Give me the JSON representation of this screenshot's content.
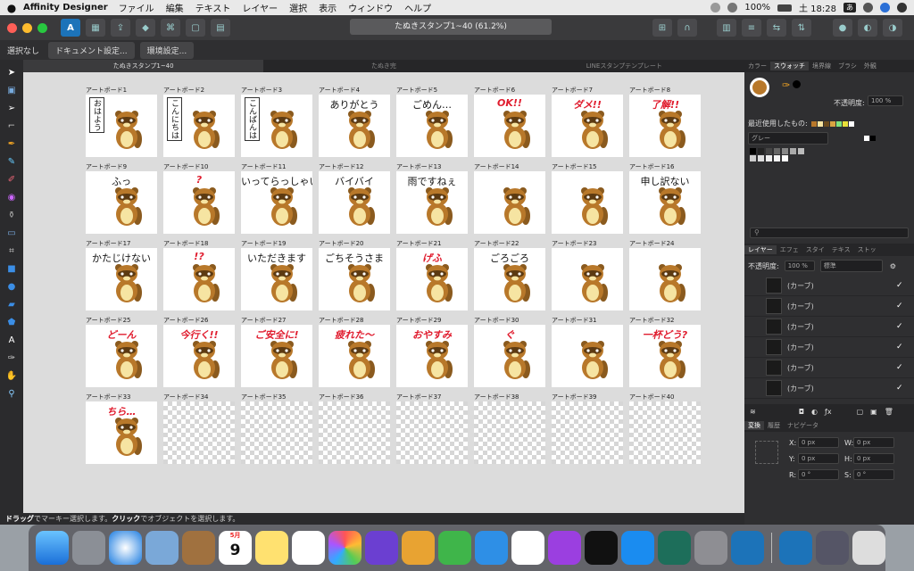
{
  "menubar": {
    "app_name": "Affinity Designer",
    "items": [
      "ファイル",
      "編集",
      "テキスト",
      "レイヤー",
      "選択",
      "表示",
      "ウィンドウ",
      "ヘルプ"
    ],
    "battery": "100%",
    "clock": "土 18:28",
    "input_badge": "あ"
  },
  "window": {
    "doc_title": "たぬきスタンプ1~40 (61.2%)"
  },
  "context_bar": {
    "selection_label": "選択なし",
    "doc_settings": "ドキュメント設定...",
    "env_settings": "環境設定..."
  },
  "doc_tabs": [
    {
      "label": "たぬきスタンプ1~40",
      "active": true
    },
    {
      "label": "たぬき完",
      "active": false
    },
    {
      "label": "LINEスタンプテンプレート",
      "active": false
    }
  ],
  "artboards": [
    {
      "label": "アートボード1",
      "caption": "おはよう",
      "style": "vert",
      "tanuki": true
    },
    {
      "label": "アートボード2",
      "caption": "こんにちは",
      "style": "vert",
      "tanuki": true
    },
    {
      "label": "アートボード3",
      "caption": "こんばんは",
      "style": "vert",
      "tanuki": true
    },
    {
      "label": "アートボード4",
      "caption": "ありがとう",
      "style": "normal",
      "tanuki": true
    },
    {
      "label": "アートボード5",
      "caption": "ごめん…",
      "style": "normal",
      "tanuki": true
    },
    {
      "label": "アートボード6",
      "caption": "OK!!",
      "style": "red",
      "tanuki": true
    },
    {
      "label": "アートボード7",
      "caption": "ダメ!!",
      "style": "red",
      "tanuki": true
    },
    {
      "label": "アートボード8",
      "caption": "了解!!",
      "style": "red",
      "tanuki": true
    },
    {
      "label": "アートボード9",
      "caption": "ふっ",
      "style": "normal",
      "tanuki": true
    },
    {
      "label": "アートボード10",
      "caption": "?",
      "style": "red",
      "tanuki": true
    },
    {
      "label": "アートボード11",
      "caption": "いってらっしゃい",
      "style": "normal",
      "tanuki": true
    },
    {
      "label": "アートボード12",
      "caption": "バイバイ",
      "style": "normal",
      "tanuki": true
    },
    {
      "label": "アートボード13",
      "caption": "雨ですねぇ",
      "style": "normal",
      "tanuki": true
    },
    {
      "label": "アートボード14",
      "caption": "",
      "style": "normal",
      "tanuki": true
    },
    {
      "label": "アートボード15",
      "caption": "",
      "style": "normal",
      "tanuki": true
    },
    {
      "label": "アートボード16",
      "caption": "申し訳ない",
      "style": "normal",
      "tanuki": true
    },
    {
      "label": "アートボード17",
      "caption": "かたじけない",
      "style": "normal",
      "tanuki": true
    },
    {
      "label": "アートボード18",
      "caption": "!?",
      "style": "red",
      "tanuki": true
    },
    {
      "label": "アートボード19",
      "caption": "いただきます",
      "style": "normal",
      "tanuki": true
    },
    {
      "label": "アートボード20",
      "caption": "ごちそうさま",
      "style": "normal",
      "tanuki": true
    },
    {
      "label": "アートボード21",
      "caption": "げふ",
      "style": "red",
      "tanuki": true
    },
    {
      "label": "アートボード22",
      "caption": "ごろごろ",
      "style": "normal",
      "tanuki": true
    },
    {
      "label": "アートボード23",
      "caption": "",
      "style": "normal",
      "tanuki": true
    },
    {
      "label": "アートボード24",
      "caption": "",
      "style": "normal",
      "tanuki": true
    },
    {
      "label": "アートボード25",
      "caption": "どーん",
      "style": "red",
      "tanuki": true
    },
    {
      "label": "アートボード26",
      "caption": "今行く!!",
      "style": "red",
      "tanuki": true
    },
    {
      "label": "アートボード27",
      "caption": "ご安全に!",
      "style": "red",
      "tanuki": true
    },
    {
      "label": "アートボード28",
      "caption": "疲れた〜",
      "style": "red",
      "tanuki": true
    },
    {
      "label": "アートボード29",
      "caption": "おやすみ",
      "style": "red",
      "tanuki": true
    },
    {
      "label": "アートボード30",
      "caption": "ぐ",
      "style": "red",
      "tanuki": true
    },
    {
      "label": "アートボード31",
      "caption": "",
      "style": "normal",
      "tanuki": true
    },
    {
      "label": "アートボード32",
      "caption": "一杯どう?",
      "style": "red",
      "tanuki": true
    },
    {
      "label": "アートボード33",
      "caption": "ちら…",
      "style": "red",
      "tanuki": true
    },
    {
      "label": "アートボード34",
      "caption": "",
      "style": "normal",
      "tanuki": false
    },
    {
      "label": "アートボード35",
      "caption": "",
      "style": "normal",
      "tanuki": false
    },
    {
      "label": "アートボード36",
      "caption": "",
      "style": "normal",
      "tanuki": false
    },
    {
      "label": "アートボード37",
      "caption": "",
      "style": "normal",
      "tanuki": false
    },
    {
      "label": "アートボード38",
      "caption": "",
      "style": "normal",
      "tanuki": false
    },
    {
      "label": "アートボード39",
      "caption": "",
      "style": "normal",
      "tanuki": false
    },
    {
      "label": "アートボード40",
      "caption": "",
      "style": "normal",
      "tanuki": false
    }
  ],
  "status_bar": {
    "drag_word": "ドラッグ",
    "drag_text": "でマーキー選択します。",
    "click_word": "クリック",
    "click_text": "でオブジェクトを選択します。"
  },
  "swatch_panel": {
    "tabs": [
      "カラー",
      "スウォッチ",
      "境界線",
      "ブラシ",
      "外観"
    ],
    "opacity_label": "不透明度:",
    "opacity_value": "100 %",
    "recent_label": "最近使用したもの:",
    "palette_name": "グレー"
  },
  "layers_panel": {
    "tabs": [
      "レイヤー",
      "エフェ",
      "スタイ",
      "テキス",
      "ストッ"
    ],
    "opacity_label": "不透明度:",
    "opacity_value": "100 %",
    "blend_mode": "標準",
    "layers": [
      "(カーブ)",
      "(カーブ)",
      "(カーブ)",
      "(カーブ)",
      "(カーブ)",
      "(カーブ)"
    ]
  },
  "transform_panel": {
    "tabs": [
      "変換",
      "履歴",
      "ナビゲータ"
    ],
    "x_label": "X:",
    "x_value": "0 px",
    "w_label": "W:",
    "w_value": "0 px",
    "y_label": "Y:",
    "y_value": "0 px",
    "h_label": "H:",
    "h_value": "0 px",
    "r_label": "R:",
    "r_value": "0 °",
    "s_label": "S:",
    "s_value": "0 °"
  },
  "colors": {
    "accent": "#1c73b9",
    "tanuki_body": "#b8782a",
    "tanuki_belly": "#f6e4a2",
    "caption_red": "#e01c2e"
  },
  "dock": {
    "calendar_month": "5月",
    "calendar_day": "9"
  }
}
